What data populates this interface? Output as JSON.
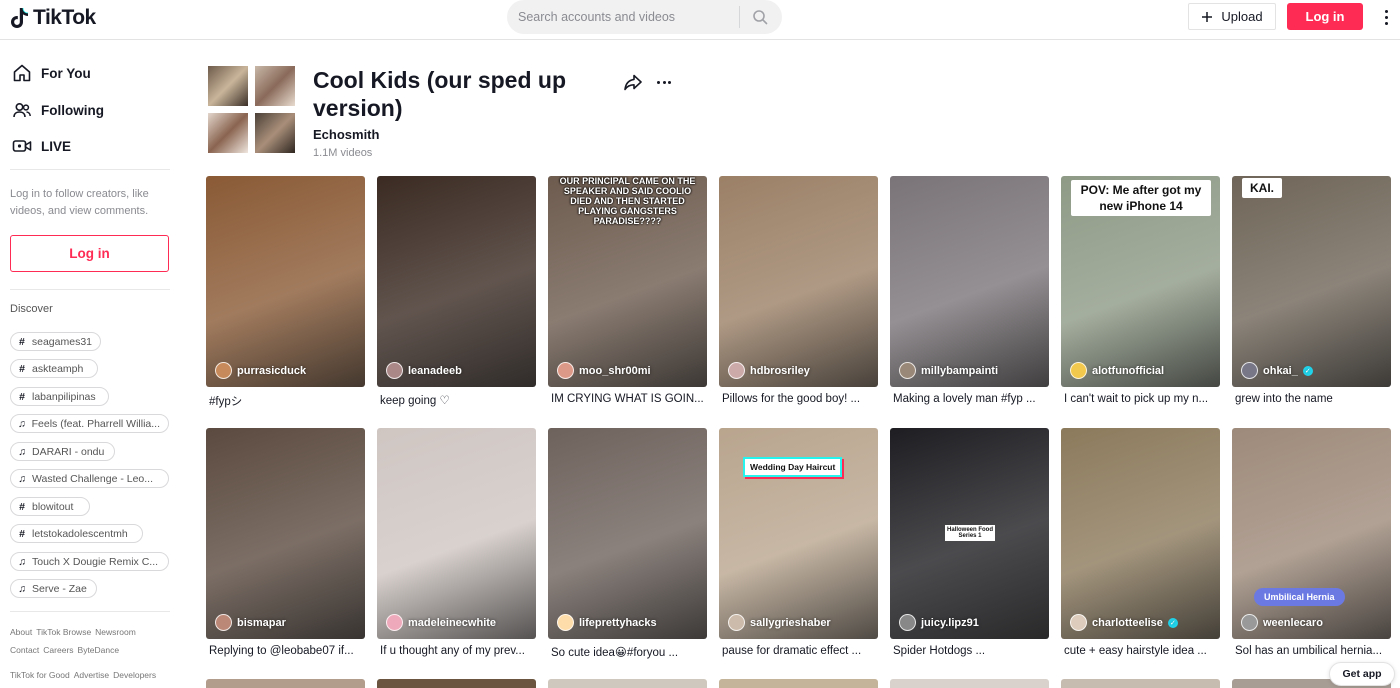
{
  "header": {
    "logo_text": "TikTok",
    "search_placeholder": "Search accounts and videos",
    "upload_label": "Upload",
    "login_label": "Log in"
  },
  "sidebar": {
    "nav": [
      {
        "label": "For You",
        "icon": "home-icon"
      },
      {
        "label": "Following",
        "icon": "users-icon"
      },
      {
        "label": "LIVE",
        "icon": "live-icon"
      }
    ],
    "hint": "Log in to follow creators, like videos, and view comments.",
    "login_label": "Log in",
    "discover_label": "Discover",
    "tags": [
      {
        "icon": "#",
        "label": "seagames31"
      },
      {
        "icon": "#",
        "label": "askteamph"
      },
      {
        "icon": "#",
        "label": "labanpilipinas"
      },
      {
        "icon": "♫",
        "label": "Feels (feat. Pharrell Willia..."
      },
      {
        "icon": "♫",
        "label": "DARARI -  ondu"
      },
      {
        "icon": "♫",
        "label": "Wasted Challenge - Leo..."
      },
      {
        "icon": "#",
        "label": "blowitout"
      },
      {
        "icon": "#",
        "label": "letstokadolescentmh"
      },
      {
        "icon": "♫",
        "label": "Touch X Dougie Remix C..."
      },
      {
        "icon": "♫",
        "label": "Serve - Zae"
      }
    ],
    "footer_rows": [
      [
        "About",
        "TikTok Browse",
        "Newsroom"
      ],
      [
        "Contact",
        "Careers",
        "ByteDance"
      ],
      [
        "TikTok for Good",
        "Advertise",
        "Developers"
      ]
    ]
  },
  "sound": {
    "title": "Cool Kids (our sped up version)",
    "artist": "Echosmith",
    "video_count": "1.1M videos"
  },
  "videos": [
    {
      "user": "purrasicduck",
      "caption": "#fypシ",
      "bg": "#8a5a35",
      "avatar": "#c78a5a",
      "verified": false
    },
    {
      "user": "leanadeeb",
      "caption": "keep going ♡",
      "bg": "#3a2a22",
      "avatar": "#a88",
      "verified": false
    },
    {
      "user": "moo_shr00mi",
      "caption": "IM CRYING WHAT IS GOIN...",
      "bg": "#6d5b4e",
      "avatar": "#d98",
      "verified": false,
      "overlay": "OUR PRINCIPAL CAME ON THE SPEAKER AND SAID COOLIO DIED AND THEN STARTED PLAYING GANGSTERS PARADISE????"
    },
    {
      "user": "hdbrosriley",
      "caption": "Pillows for the good boy! ...",
      "bg": "#9b8066",
      "avatar": "#caa",
      "verified": false
    },
    {
      "user": "millybampainti",
      "caption": "Making a lovely man #fyp ...",
      "bg": "#7a7478",
      "avatar": "#987",
      "verified": false
    },
    {
      "user": "alotfunofficial",
      "caption": "I can't wait to pick up my n...",
      "bg": "#8e9a86",
      "avatar": "#f2c94c",
      "verified": false,
      "overlay": "POV: Me after got my new iPhone 14"
    },
    {
      "user": "ohkai_",
      "caption": "grew into the name",
      "bg": "#6f6558",
      "avatar": "#778",
      "verified": true,
      "overlay": "KAI."
    },
    {
      "user": "bismapar",
      "caption": "Replying to @leobabe07 if...",
      "bg": "#5b4a3f",
      "avatar": "#b87",
      "verified": false
    },
    {
      "user": "madeleinecwhite",
      "caption": "If u thought any of my prev...",
      "bg": "#cfc6c2",
      "avatar": "#eab",
      "verified": false
    },
    {
      "user": "lifeprettyhacks",
      "caption": "So cute idea😀#foryou ...",
      "bg": "#6e625c",
      "avatar": "#fda",
      "verified": false
    },
    {
      "user": "sallygrieshaber",
      "caption": "pause for dramatic effect ...",
      "bg": "#b9a58e",
      "avatar": "#cba",
      "verified": false,
      "overlay": "Wedding Day Haircut"
    },
    {
      "user": "juicy.lipz91",
      "caption": "Spider Hotdogs ...",
      "bg": "#1e1e22",
      "avatar": "#888",
      "verified": false,
      "overlay": "Halloween Food Series 1"
    },
    {
      "user": "charlotteelise",
      "caption": "cute + easy hairstyle idea ...",
      "bg": "#8c7a5c",
      "avatar": "#dcb",
      "verified": true
    },
    {
      "user": "weenlecaro",
      "caption": "Sol has an umbilical hernia...",
      "bg": "#9e8a7a",
      "avatar": "#999",
      "verified": false,
      "overlay": "Umbilical Hernia"
    }
  ],
  "get_app_label": "Get app",
  "colors": {
    "accent": "#fe2c55",
    "text": "#161823",
    "muted": "#8a8b91"
  }
}
